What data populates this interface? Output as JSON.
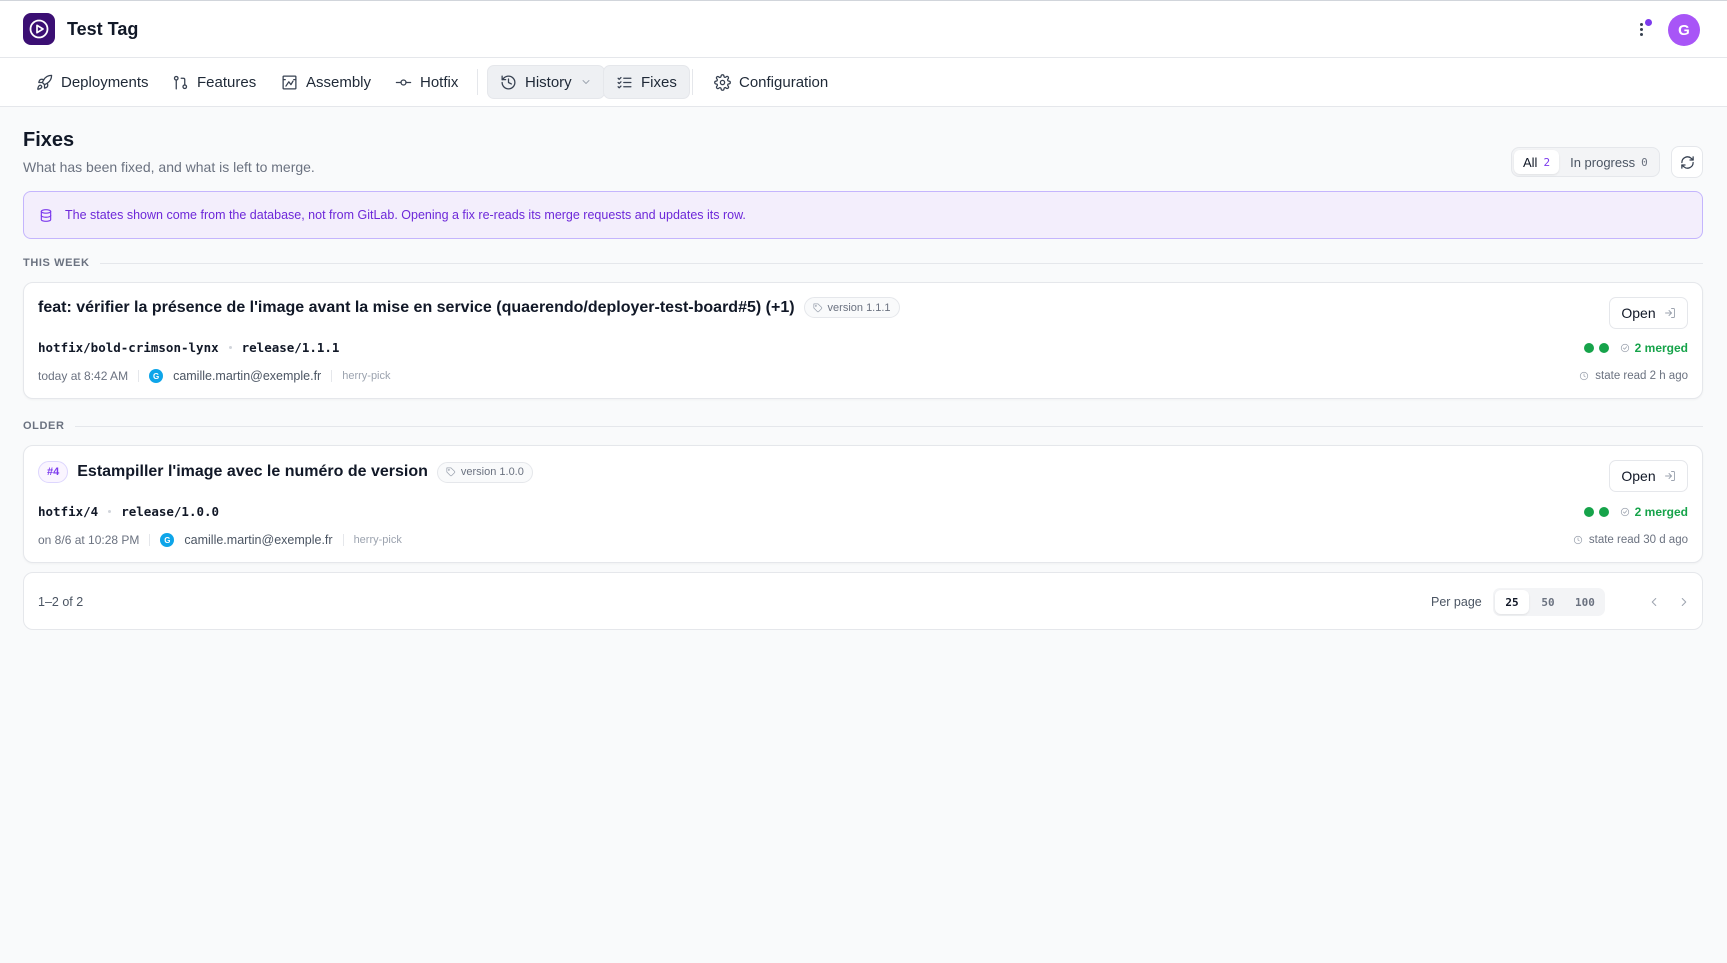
{
  "app": {
    "title": "Test Tag",
    "avatar_initial": "G",
    "accent": "#7c3aed",
    "logo_color": "#3b0f73"
  },
  "nav": {
    "items": [
      {
        "label": "Deployments",
        "icon": "rocket-icon"
      },
      {
        "label": "Features",
        "icon": "git-pull-request-icon"
      },
      {
        "label": "Assembly",
        "icon": "assembly-icon"
      },
      {
        "label": "Hotfix",
        "icon": "git-commit-icon"
      },
      {
        "label": "History",
        "icon": "history-icon",
        "has_dropdown": true
      },
      {
        "label": "Fixes",
        "icon": "list-checks-icon",
        "active": true
      },
      {
        "label": "Configuration",
        "icon": "gear-icon"
      }
    ]
  },
  "page": {
    "title": "Fixes",
    "subtitle": "What has been fixed, and what is left to merge."
  },
  "filters": {
    "all_label": "All",
    "all_count": "2",
    "in_progress_label": "In progress",
    "in_progress_count": "0"
  },
  "banner": {
    "icon": "database-icon",
    "text": "The states shown come from the database, not from GitLab. Opening a fix re-reads its merge requests and updates its row."
  },
  "sections": [
    {
      "label": "THIS WEEK",
      "fixes": [
        {
          "issue": "",
          "title": "feat: vérifier la présence de l'image avant la mise en service (quaerendo/deployer-test-board#5) (+1)",
          "version": "version 1.1.1",
          "source_branch": "hotfix/bold-crimson-lynx",
          "target_branch": "release/1.1.1",
          "date": "today at 8:42 AM",
          "author_initial": "G",
          "author": "camille.martin@exemple.fr",
          "kind": "herry-pick",
          "open_label": "Open",
          "merged_label": "2 merged",
          "merged_count": 2,
          "state_read": "state read 2 h ago"
        }
      ]
    },
    {
      "label": "OLDER",
      "fixes": [
        {
          "issue": "#4",
          "title": "Estampiller l'image avec le numéro de version",
          "version": "version 1.0.0",
          "source_branch": "hotfix/4",
          "target_branch": "release/1.0.0",
          "date": "on 8/6 at 10:28 PM",
          "author_initial": "G",
          "author": "camille.martin@exemple.fr",
          "kind": "herry-pick",
          "open_label": "Open",
          "merged_label": "2 merged",
          "merged_count": 2,
          "state_read": "state read 30 d ago"
        }
      ]
    }
  ],
  "pagination": {
    "range": "1–2 of 2",
    "per_page_label": "Per page",
    "options": [
      "25",
      "50",
      "100"
    ],
    "selected": "25"
  },
  "colors": {
    "merged": "#16a34a",
    "banner_bg": "#f3eefc",
    "banner_text": "#6d28d9"
  }
}
